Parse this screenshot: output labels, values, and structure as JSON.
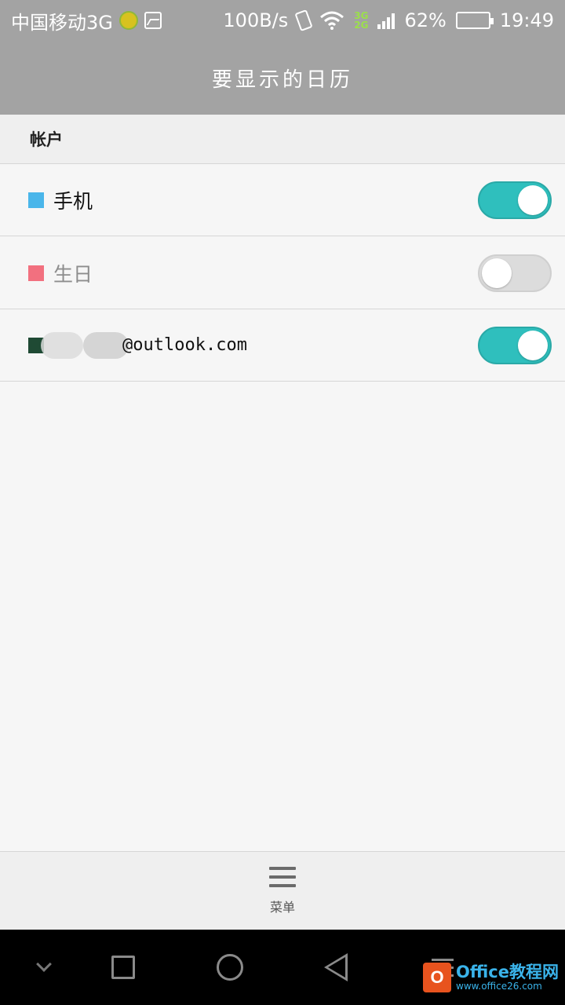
{
  "status_bar": {
    "carrier": "中国移动3G",
    "speed": "100B/s",
    "network_badge_top": "3G",
    "network_badge_bottom": "2G",
    "battery": "62%",
    "battery_level": 0.62,
    "time": "19:49"
  },
  "header": {
    "title": "要显示的日历"
  },
  "section": {
    "title": "帐户"
  },
  "calendars": [
    {
      "label": "手机",
      "color": "#4ab6ea",
      "enabled": true
    },
    {
      "label": "生日",
      "color": "#f2707f",
      "enabled": false
    },
    {
      "label": "@outlook.com",
      "color": "#1f4a34",
      "enabled": true,
      "redacted_prefix": true
    }
  ],
  "bottom_menu": {
    "label": "菜单",
    "icon": "menu-icon"
  },
  "nav_bar": {
    "icons": [
      "chevron-down-icon",
      "recents-icon",
      "home-icon",
      "back-icon",
      "menu-icon"
    ]
  },
  "watermark": {
    "title": "Office教程网",
    "url": "www.office26.com",
    "logo_letter": "O"
  }
}
